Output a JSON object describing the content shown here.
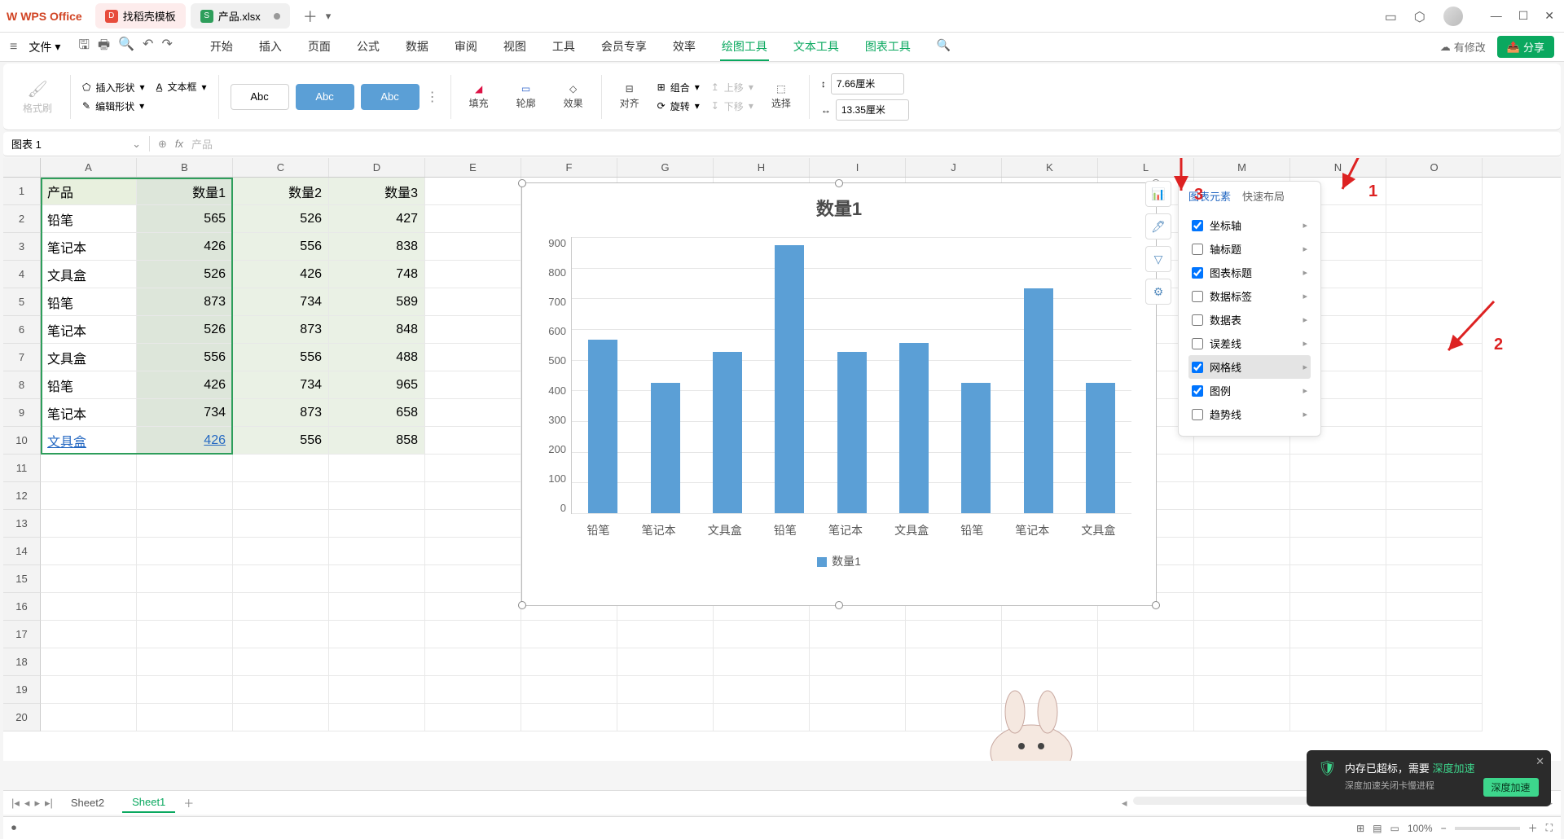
{
  "app": {
    "name": "WPS Office"
  },
  "tabs": {
    "template": "找稻壳模板",
    "file": "产品.xlsx"
  },
  "menu": {
    "file": "文件",
    "items": [
      "开始",
      "插入",
      "页面",
      "公式",
      "数据",
      "审阅",
      "视图",
      "工具",
      "会员专享",
      "效率",
      "绘图工具",
      "文本工具",
      "图表工具"
    ],
    "changes": "有修改",
    "share": "分享"
  },
  "ribbon": {
    "format_painter": "格式刷",
    "insert_shape": "插入形状",
    "textbox": "文本框",
    "edit_shape": "编辑形状",
    "style_abc": "Abc",
    "fill": "填充",
    "outline": "轮廓",
    "effects": "效果",
    "align": "对齐",
    "group": "组合",
    "rotate": "旋转",
    "up": "上移",
    "down": "下移",
    "select": "选择",
    "height": "7.66厘米",
    "width": "13.35厘米"
  },
  "formula": {
    "name_box": "图表 1",
    "fx": "fx",
    "content": "产品"
  },
  "columns": [
    "A",
    "B",
    "C",
    "D",
    "E",
    "F",
    "G",
    "H",
    "I",
    "J",
    "K",
    "L",
    "M",
    "N",
    "O"
  ],
  "rows": [
    "1",
    "2",
    "3",
    "4",
    "5",
    "6",
    "7",
    "8",
    "9",
    "10",
    "11",
    "12",
    "13",
    "14",
    "15",
    "16",
    "17",
    "18",
    "19",
    "20"
  ],
  "table": {
    "headers": [
      "产品",
      "数量1",
      "数量2",
      "数量3"
    ],
    "data": [
      [
        "铅笔",
        "565",
        "526",
        "427"
      ],
      [
        "笔记本",
        "426",
        "556",
        "838"
      ],
      [
        "文具盒",
        "526",
        "426",
        "748"
      ],
      [
        "铅笔",
        "873",
        "734",
        "589"
      ],
      [
        "笔记本",
        "526",
        "873",
        "848"
      ],
      [
        "文具盒",
        "556",
        "556",
        "488"
      ],
      [
        "铅笔",
        "426",
        "734",
        "965"
      ],
      [
        "笔记本",
        "734",
        "873",
        "658"
      ],
      [
        "文具盒",
        "426",
        "556",
        "858"
      ]
    ]
  },
  "chart_data": {
    "type": "bar",
    "title": "数量1",
    "categories": [
      "铅笔",
      "笔记本",
      "文具盒",
      "铅笔",
      "笔记本",
      "文具盒",
      "铅笔",
      "笔记本",
      "文具盒"
    ],
    "values": [
      565,
      426,
      526,
      873,
      526,
      556,
      426,
      734,
      426
    ],
    "ylim": [
      0,
      900
    ],
    "yticks": [
      0,
      100,
      200,
      300,
      400,
      500,
      600,
      700,
      800,
      900
    ],
    "legend": "数量1",
    "xlabel": "",
    "ylabel": ""
  },
  "side_panel": {
    "tab_elements": "图表元素",
    "tab_layout": "快速布局",
    "items": [
      {
        "label": "坐标轴",
        "checked": true,
        "arrow": true
      },
      {
        "label": "轴标题",
        "checked": false,
        "arrow": true
      },
      {
        "label": "图表标题",
        "checked": true,
        "arrow": true
      },
      {
        "label": "数据标签",
        "checked": false,
        "arrow": true
      },
      {
        "label": "数据表",
        "checked": false,
        "arrow": true
      },
      {
        "label": "误差线",
        "checked": false,
        "arrow": true
      },
      {
        "label": "网格线",
        "checked": true,
        "arrow": true,
        "highlight": true
      },
      {
        "label": "图例",
        "checked": true,
        "arrow": true
      },
      {
        "label": "趋势线",
        "checked": false,
        "arrow": true
      }
    ]
  },
  "annotations": {
    "n1": "1",
    "n2": "2",
    "n3": "3"
  },
  "sheets": {
    "s1": "Sheet2",
    "s2": "Sheet1"
  },
  "notif": {
    "title_a": "内存已超标，需要 ",
    "title_b": "深度加速",
    "sub": "深度加速关闭卡慢进程",
    "btn": "深度加速"
  },
  "status": {
    "zoom": "100%"
  }
}
